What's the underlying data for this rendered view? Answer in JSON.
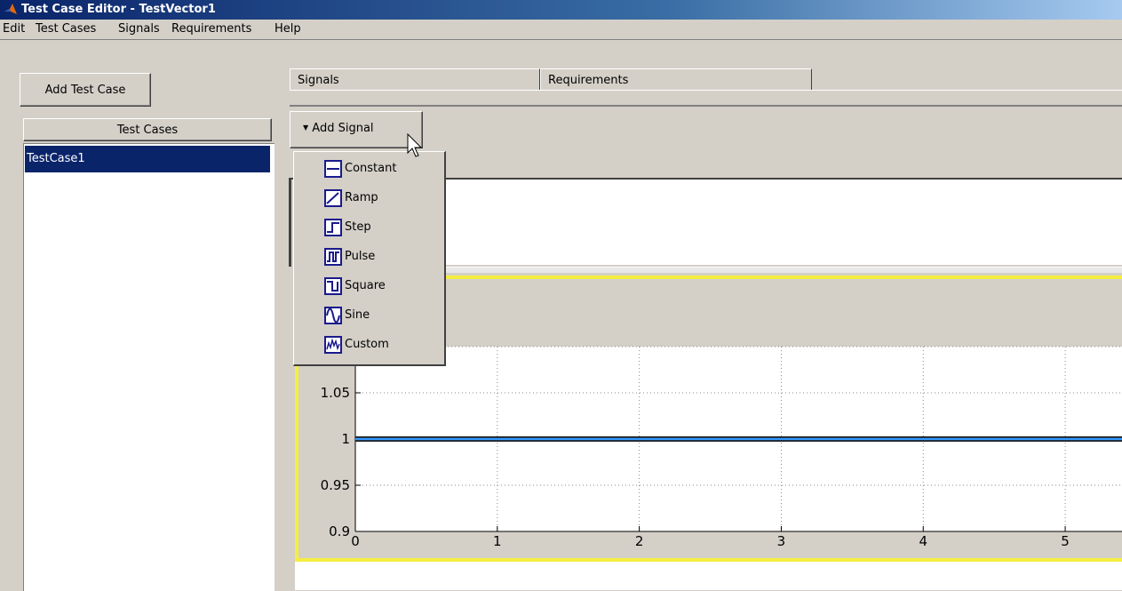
{
  "window": {
    "title": "Test Case Editor - TestVector1"
  },
  "menu": [
    "Edit",
    "Test Cases",
    "Signals",
    "Requirements",
    "Help"
  ],
  "left_panel": {
    "add_button": "Add Test Case",
    "list_header": "Test Cases",
    "items": [
      "TestCase1"
    ]
  },
  "tabs": [
    "Signals",
    "Requirements"
  ],
  "add_signal": {
    "label": "Add Signal"
  },
  "signal_menu": [
    "Constant",
    "Ramp",
    "Step",
    "Pulse",
    "Square",
    "Sine",
    "Custom"
  ],
  "icons": {
    "app": "matlab-icon",
    "signals": [
      "constant-icon",
      "ramp-icon",
      "step-icon",
      "pulse-icon",
      "square-icon",
      "sine-icon",
      "custom-icon"
    ]
  },
  "colors": {
    "selection": "#0a246a",
    "frame_highlight": "#f5ee40",
    "signal_line": "#3399ff"
  },
  "chart_data": {
    "type": "line",
    "xlim": [
      0,
      5.4
    ],
    "ylim": [
      0.9,
      1.1
    ],
    "xticks": [
      "0",
      "1",
      "2",
      "3",
      "4",
      "5"
    ],
    "yticks": [
      "0.9",
      "0.95",
      "1",
      "1.05"
    ],
    "grid": true,
    "series": [
      {
        "x": [
          0,
          5.4
        ],
        "y": [
          1,
          1
        ]
      }
    ]
  }
}
